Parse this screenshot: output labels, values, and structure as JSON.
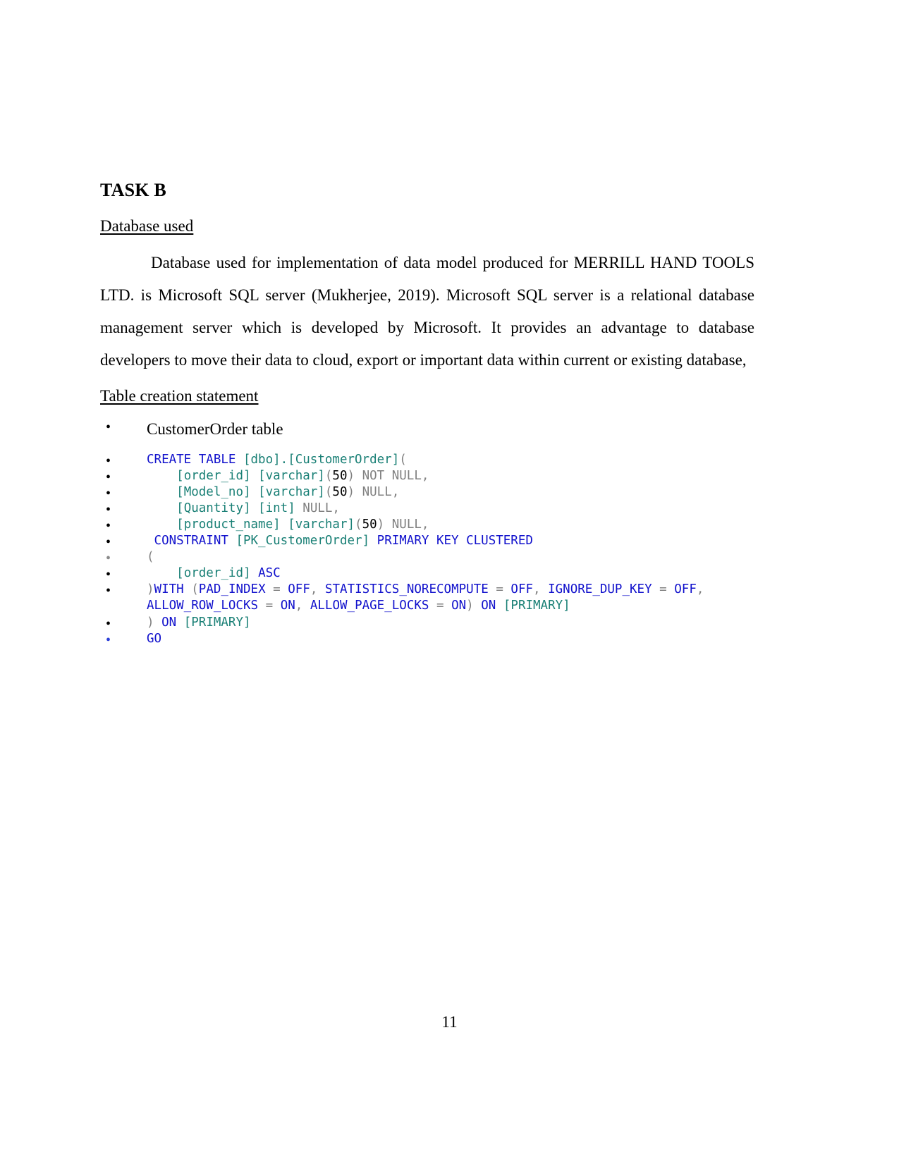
{
  "document": {
    "page_number": "11",
    "task_heading": "TASK B",
    "section_1_heading": "Database used",
    "paragraph_1": "Database used for implementation of data model produced for MERRILL HAND TOOLS LTD. is Microsoft SQL server (Mukherjee, 2019). Microsoft SQL server is a relational database management server which is developed by Microsoft. It provides an advantage to database developers to move their data to cloud, export or important data within current or existing database,",
    "section_2_heading": "Table creation statement",
    "table_bullet": "CustomerOrder table"
  },
  "code_block": {
    "language": "sql",
    "colors": {
      "keyword": "#1111cc",
      "identifier": "#1a8076",
      "number": "#000000",
      "punctuation": "#808080",
      "null_literal": "#808080"
    },
    "lines": [
      "CREATE TABLE [dbo].[CustomerOrder](",
      "    [order_id] [varchar](50) NOT NULL,",
      "    [Model_no] [varchar](50) NULL,",
      "    [Quantity] [int] NULL,",
      "    [product_name] [varchar](50) NULL,",
      " CONSTRAINT [PK_CustomerOrder] PRIMARY KEY CLUSTERED",
      "(",
      "    [order_id] ASC",
      ")WITH (PAD_INDEX = OFF, STATISTICS_NORECOMPUTE = OFF, IGNORE_DUP_KEY = OFF, ALLOW_ROW_LOCKS = ON, ALLOW_PAGE_LOCKS = ON) ON [PRIMARY]",
      ") ON [PRIMARY]",
      "GO"
    ]
  }
}
